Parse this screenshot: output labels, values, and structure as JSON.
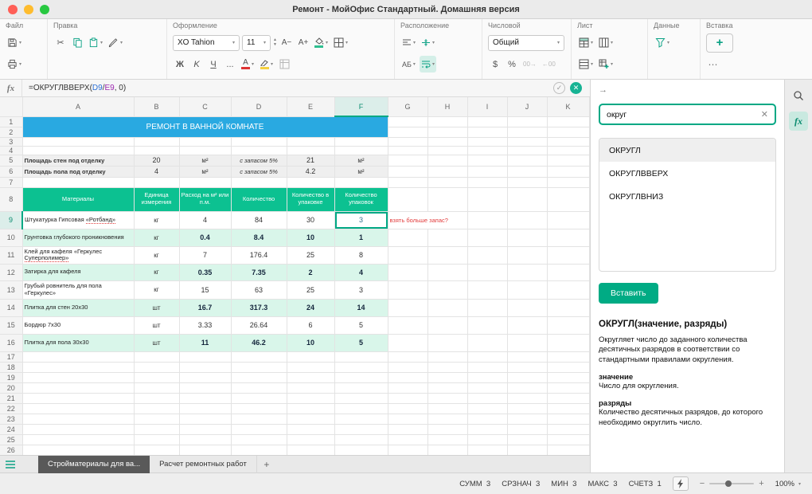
{
  "window": {
    "title": "Ремонт - МойОфис Стандартный. Домашняя версия"
  },
  "toolbar": {
    "sections": [
      "Файл",
      "Правка",
      "Оформление",
      "Расположение",
      "Числовой",
      "Лист",
      "Данные",
      "Вставка"
    ],
    "font_name": "XO Tahion",
    "font_size": "11",
    "bold": "Ж",
    "italic": "K",
    "underline": "Ч",
    "more": "...",
    "font_color_letter": "А",
    "orientation": "АБ",
    "number_format": "Общий",
    "currency": "$",
    "percent": "%",
    "insert_plus": "+"
  },
  "formula_bar": {
    "fx_label": "fx",
    "formula_full": "=ОКРУГЛВВЕРХ(D9/E9, 0)",
    "parts": [
      {
        "text": "=ОКРУГЛВВЕРХ(",
        "kind": "t"
      },
      {
        "text": "D9",
        "kind": "r1"
      },
      {
        "text": "/",
        "kind": "t"
      },
      {
        "text": "E9",
        "kind": "r2"
      },
      {
        "text": ", 0)",
        "kind": "t"
      }
    ]
  },
  "grid": {
    "columns": [
      "A",
      "B",
      "C",
      "D",
      "E",
      "F",
      "G",
      "H",
      "I",
      "J",
      "K"
    ],
    "selected_cell": "F9",
    "banner": "РЕМОНТ В ВАННОЙ КОМНАТЕ",
    "area_rows": [
      {
        "label": "Площадь стен под отделку",
        "value": "20",
        "unit": "м²",
        "note": "с запасом 5%",
        "value_margin": "21",
        "unit2": "м²"
      },
      {
        "label": "Площадь пола под отделку",
        "value": "4",
        "unit": "м²",
        "note": "с запасом 5%",
        "value_margin": "4.2",
        "unit2": "м²"
      }
    ],
    "table": {
      "headers": [
        "Материалы",
        "Единица измерения",
        "Расход на м² или п.м.",
        "Количество",
        "Количество в упаковке",
        "Количество упаковок"
      ],
      "rows": [
        {
          "name": "Штукатурка Гипсовая «Ротбанд»",
          "misspelled_part": "«Ротбанд»",
          "unit": "кг",
          "rate": "4",
          "quantity": "84",
          "per_pack": "30",
          "packs": "3",
          "green": false,
          "selected": true,
          "comment": "взять больше запас?"
        },
        {
          "name": "Грунтовка глубокого проникновения",
          "unit": "кг",
          "rate": "0.4",
          "quantity": "8.4",
          "per_pack": "10",
          "packs": "1",
          "green": true
        },
        {
          "name": "Клей для кафеля «Геркулес Суперполимер»",
          "misspelled_part": "Суперполимер»",
          "unit": "кг",
          "rate": "7",
          "quantity": "176.4",
          "per_pack": "25",
          "packs": "8",
          "green": false
        },
        {
          "name": "Затирка для кафеля",
          "unit": "кг",
          "rate": "0.35",
          "quantity": "7.35",
          "per_pack": "2",
          "packs": "4",
          "green": true
        },
        {
          "name": "Грубый ровнитель для пола «Геркулес»",
          "unit": "кг",
          "rate": "15",
          "quantity": "63",
          "per_pack": "25",
          "packs": "3",
          "green": false
        },
        {
          "name": "Плитка для стен 20x30",
          "unit": "шт",
          "rate": "16.7",
          "quantity": "317.3",
          "per_pack": "24",
          "packs": "14",
          "green": true
        },
        {
          "name": "Бордюр 7x30",
          "unit": "шт",
          "rate": "3.33",
          "quantity": "26.64",
          "per_pack": "6",
          "packs": "5",
          "green": false
        },
        {
          "name": "Плитка для пола 30x30",
          "unit": "шт",
          "rate": "11",
          "quantity": "46.2",
          "per_pack": "10",
          "packs": "5",
          "green": true
        }
      ]
    }
  },
  "panel": {
    "search_value": "округ",
    "functions": [
      "ОКРУГЛ",
      "ОКРУГЛВВЕРХ",
      "ОКРУГЛВНИЗ"
    ],
    "selected_index": 0,
    "insert_label": "Вставить",
    "doc_title": "ОКРУГЛ(значение, разряды)",
    "doc_text": "Округляет число до заданного количества десятичных разрядов в соответствии со стандартными правилами округления.",
    "arg1_name": "значение",
    "arg1_desc": "Число для округления.",
    "arg2_name": "разряды",
    "arg2_desc": "Количество десятичных разрядов, до которого необходимо округлить число."
  },
  "sheet_tabs": [
    {
      "label": "Стройматериалы для ва...",
      "active": true
    },
    {
      "label": "Расчет ремонтных работ",
      "active": false
    }
  ],
  "status_bar": {
    "stats": [
      {
        "label": "СУММ",
        "value": "3"
      },
      {
        "label": "СРЗНАЧ",
        "value": "3"
      },
      {
        "label": "МИН",
        "value": "3"
      },
      {
        "label": "МАКС",
        "value": "3"
      },
      {
        "label": "СЧЕТЗ",
        "value": "1"
      }
    ],
    "zoom": "100%"
  }
}
